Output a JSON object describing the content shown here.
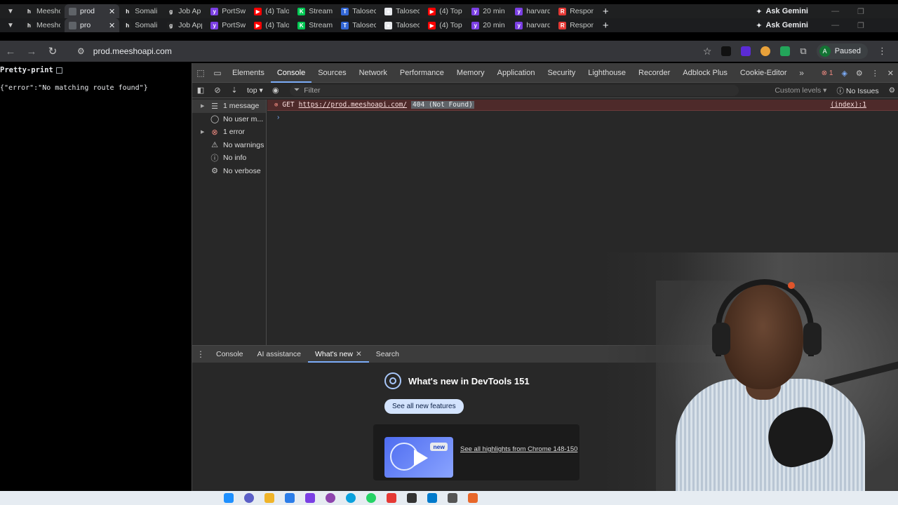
{
  "browser": {
    "tabs_row1": [
      {
        "title": "Meesho",
        "color": "#1f2021",
        "glyph": "h"
      },
      {
        "title": "prod",
        "color": "#5f6368",
        "glyph": "",
        "active": true
      },
      {
        "title": "Somali",
        "color": "#1f2021",
        "glyph": "h"
      },
      {
        "title": "Job Ap",
        "color": "#1f2021",
        "glyph": "g"
      },
      {
        "title": "PortSw",
        "color": "#7b3fe4",
        "glyph": "y"
      },
      {
        "title": "(4) Talo",
        "color": "#ff0000",
        "glyph": "▶"
      },
      {
        "title": "Stream",
        "color": "#00c853",
        "glyph": "K"
      },
      {
        "title": "Talosec",
        "color": "#3367d6",
        "glyph": "T"
      },
      {
        "title": "Talosec",
        "color": "#e8eaed",
        "glyph": "●"
      },
      {
        "title": "(4) Top",
        "color": "#ff0000",
        "glyph": "▶"
      },
      {
        "title": "20 min",
        "color": "#7b3fe4",
        "glyph": "y"
      },
      {
        "title": "harvard",
        "color": "#7b3fe4",
        "glyph": "y"
      },
      {
        "title": "Respon",
        "color": "#e53935",
        "glyph": "R"
      }
    ],
    "tabs_row2": [
      {
        "title": "Meesho",
        "color": "#1f2021",
        "glyph": "h"
      },
      {
        "title": "pro",
        "color": "#5f6368",
        "glyph": "",
        "active": true
      },
      {
        "title": "Somali",
        "color": "#1f2021",
        "glyph": "h"
      },
      {
        "title": "Job App",
        "color": "#1f2021",
        "glyph": "g"
      },
      {
        "title": "PortSw",
        "color": "#7b3fe4",
        "glyph": "y"
      },
      {
        "title": "(4) Talo",
        "color": "#ff0000",
        "glyph": "▶"
      },
      {
        "title": "Stream",
        "color": "#00c853",
        "glyph": "K"
      },
      {
        "title": "Talosec",
        "color": "#3367d6",
        "glyph": "T"
      },
      {
        "title": "Talosec",
        "color": "#e8eaed",
        "glyph": "●"
      },
      {
        "title": "(4) Top",
        "color": "#ff0000",
        "glyph": "▶"
      },
      {
        "title": "20 min",
        "color": "#7b3fe4",
        "glyph": "y"
      },
      {
        "title": "harvard",
        "color": "#7b3fe4",
        "glyph": "y"
      },
      {
        "title": "Respon",
        "color": "#e53935",
        "glyph": "R"
      }
    ],
    "gemini_label": "Ask Gemini",
    "url": "prod.meeshoapi.com",
    "profile_initial": "A",
    "profile_status": "Paused"
  },
  "page": {
    "pretty_print_label": "Pretty-print",
    "json_body": "{\"error\":\"No matching route found\"}"
  },
  "devtools": {
    "tabs": [
      "Elements",
      "Console",
      "Sources",
      "Network",
      "Performance",
      "Memory",
      "Application",
      "Security",
      "Lighthouse",
      "Recorder",
      "Adblock Plus",
      "Cookie-Editor"
    ],
    "active_tab": "Console",
    "error_count": "1",
    "console_toolbar": {
      "context": "top",
      "filter_placeholder": "Filter",
      "levels": "Custom levels",
      "issues": "No Issues"
    },
    "sidebar": [
      {
        "label": "1 message",
        "icon": "list-icon",
        "glyph": "☰",
        "arrow": "▶",
        "selected": true
      },
      {
        "label": "No user m...",
        "icon": "user-icon",
        "glyph": "◯",
        "arrow": ""
      },
      {
        "label": "1 error",
        "icon": "error-icon",
        "glyph": "⊗",
        "arrow": "▶",
        "red": true
      },
      {
        "label": "No warnings",
        "icon": "warning-icon",
        "glyph": "⚠",
        "arrow": ""
      },
      {
        "label": "No info",
        "icon": "info-icon",
        "glyph": "ⓘ",
        "arrow": ""
      },
      {
        "label": "No verbose",
        "icon": "bug-icon",
        "glyph": "⚙",
        "arrow": ""
      }
    ],
    "log": {
      "method": "GET",
      "url": "https://prod.meeshoapi.com/",
      "status": "404 (Not Found)",
      "source": "(index):1"
    },
    "drawer": {
      "tabs": [
        "Console",
        "AI assistance",
        "What's new",
        "Search"
      ],
      "active_tab": "What's new",
      "heading": "What's new in DevTools 151",
      "see_all_button": "See all new features",
      "new_badge": "new",
      "highlights_link": "See all highlights from Chrome 148-150"
    }
  },
  "colors": {
    "accent": "#7cacf8",
    "error_bg": "#4e2a2a",
    "error_text": "#f28b82"
  }
}
